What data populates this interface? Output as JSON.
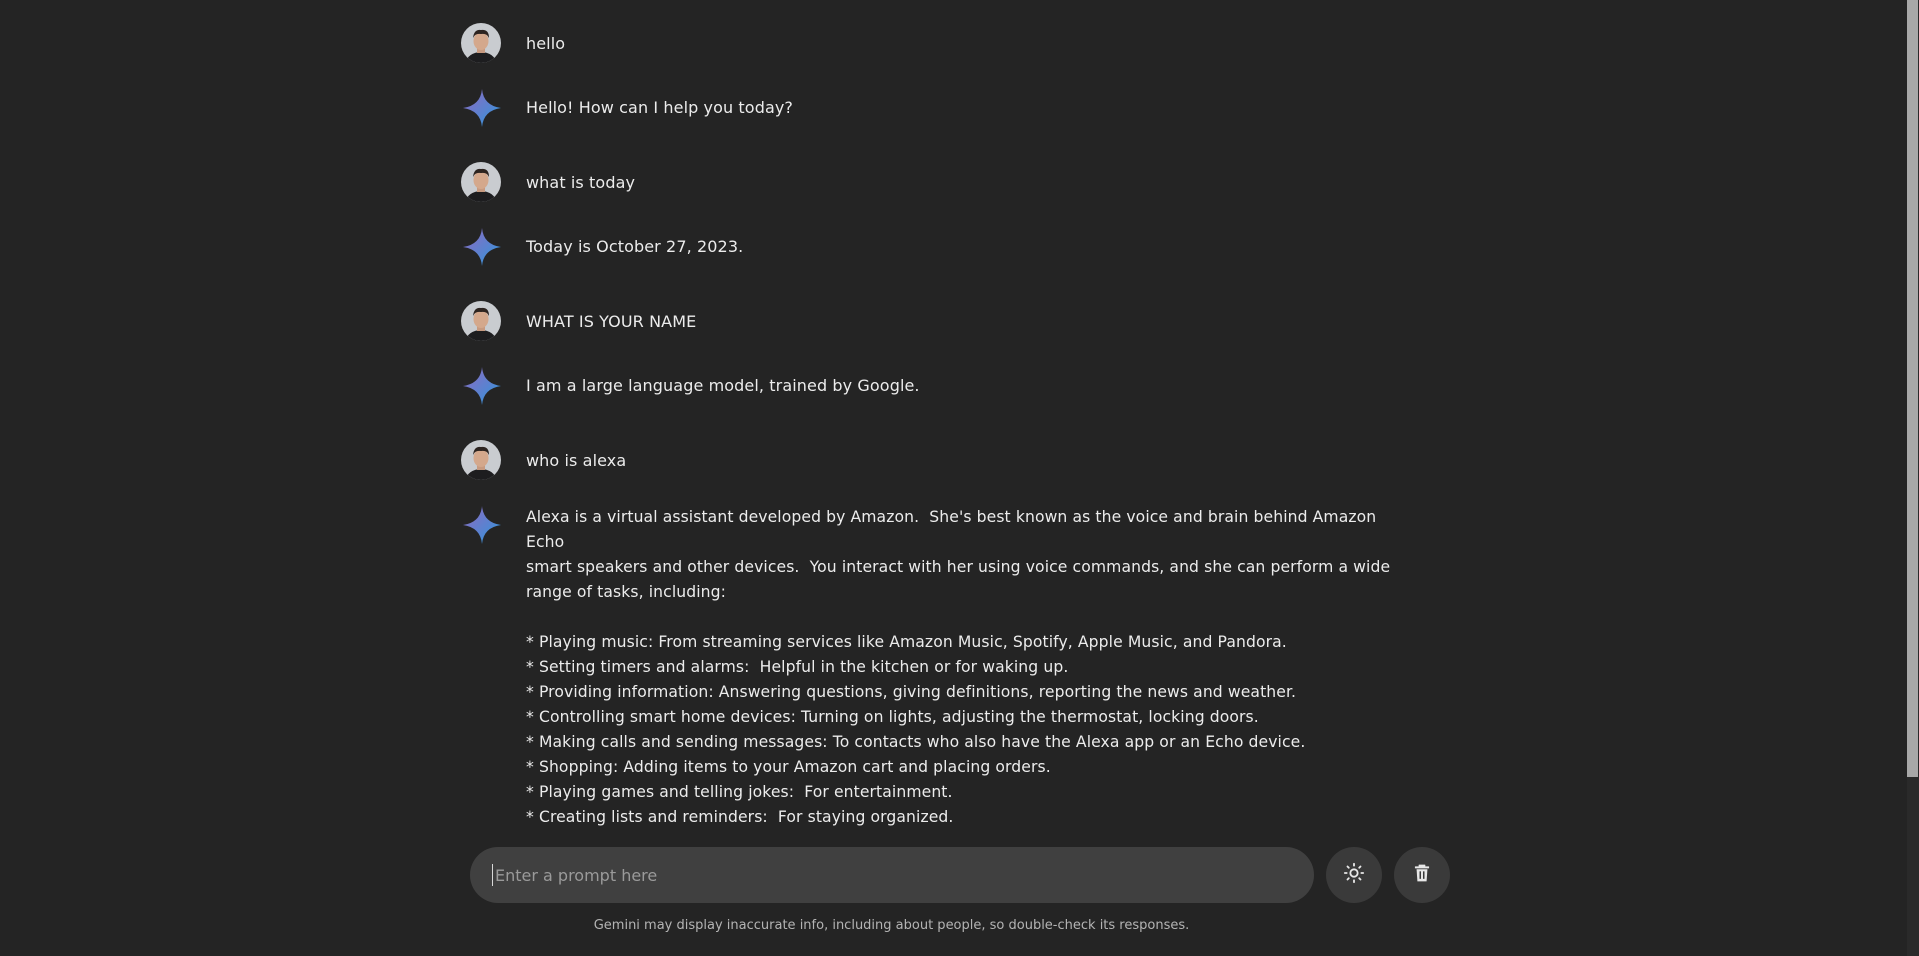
{
  "conversation": [
    {
      "role": "user",
      "text": "hello"
    },
    {
      "role": "model",
      "text": "Hello! How can I help you today?"
    },
    {
      "role": "user",
      "text": "what is today"
    },
    {
      "role": "model",
      "text": "Today is October 27, 2023."
    },
    {
      "role": "user",
      "text": "WHAT IS YOUR NAME"
    },
    {
      "role": "model",
      "text": "I am a large language model, trained by Google."
    },
    {
      "role": "user",
      "text": "who is alexa"
    },
    {
      "role": "model",
      "text": "Alexa is a virtual assistant developed by Amazon.  She's best known as the voice and brain behind Amazon Echo\nsmart speakers and other devices.  You interact with her using voice commands, and she can perform a wide\nrange of tasks, including:\n\n* Playing music: From streaming services like Amazon Music, Spotify, Apple Music, and Pandora.\n* Setting timers and alarms:  Helpful in the kitchen or for waking up.\n* Providing information: Answering questions, giving definitions, reporting the news and weather.\n* Controlling smart home devices: Turning on lights, adjusting the thermostat, locking doors.\n* Making calls and sending messages: To contacts who also have the Alexa app or an Echo device.\n* Shopping: Adding items to your Amazon cart and placing orders.\n* Playing games and telling jokes:  For entertainment.\n* Creating lists and reminders:  For staying organized."
    }
  ],
  "prompt": {
    "placeholder": "Enter a prompt here",
    "value": ""
  },
  "buttons": {
    "theme_icon": "sun-icon",
    "clear_icon": "trash-icon"
  },
  "disclaimer": "Gemini may display inaccurate info, including about people, so double-check its responses.",
  "colors": {
    "background": "#242424",
    "input_background": "#404040",
    "button_background": "#3a3a3a",
    "gem_gradient_start": "#9168c0",
    "gem_gradient_end": "#1ba1e3"
  }
}
